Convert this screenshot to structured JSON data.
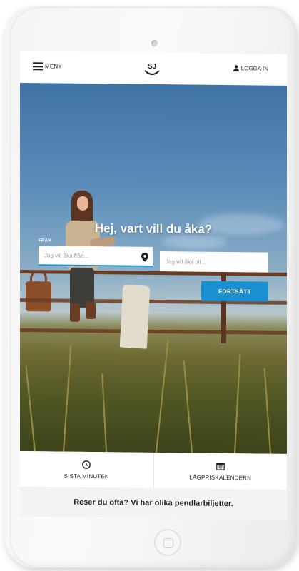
{
  "header": {
    "menu_label": "MENY",
    "logo_text": "SJ",
    "login_label": "LOGGA IN"
  },
  "search": {
    "headline": "Hej, vart vill du åka?",
    "from_label": "FRÅN",
    "from_placeholder": "Jag vill åka från...",
    "to_placeholder": "Jag vill åka till...",
    "continue_label": "FORTSÄTT"
  },
  "quicklinks": [
    {
      "label": "SISTA MINUTEN",
      "icon": "clock-icon"
    },
    {
      "label": "LÅGPRISKALENDERN",
      "icon": "calendar-icon"
    }
  ],
  "promo": {
    "text": "Reser du ofta? Vi har olika pendlarbiljetter."
  },
  "colors": {
    "accent": "#1c8fd0",
    "text": "#222222"
  }
}
